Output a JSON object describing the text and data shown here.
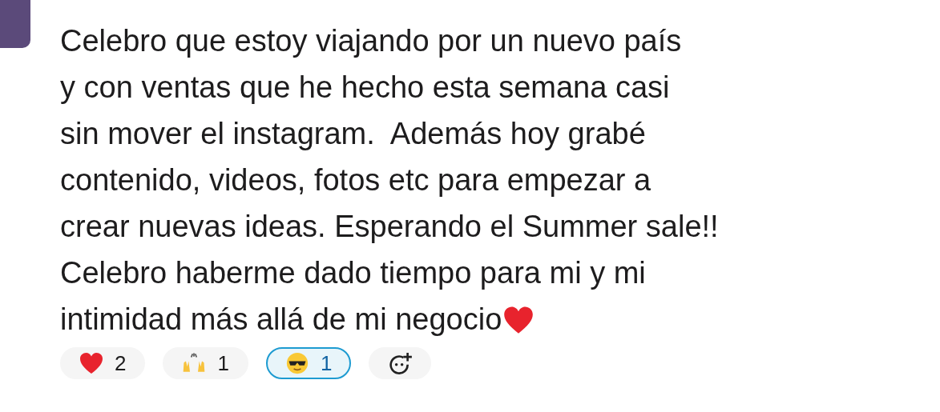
{
  "message": {
    "lines": [
      "Celebro que estoy viajando por un nuevo país",
      "y con ventas que he hecho esta semana casi",
      "sin mover el instagram.  Además hoy grabé",
      "contenido, videos, fotos etc para empezar a",
      "crear nuevas ideas. Esperando el Summer sale!!",
      "Celebro haberme dado tiempo para mi y mi",
      "intimidad más allá de mi negocio"
    ]
  },
  "reactions": [
    {
      "kind": "heart",
      "count": "2",
      "selected": false
    },
    {
      "kind": "hands",
      "count": "1",
      "selected": false
    },
    {
      "kind": "sunglasses",
      "count": "1",
      "selected": true
    },
    {
      "kind": "add",
      "selected": false
    }
  ]
}
